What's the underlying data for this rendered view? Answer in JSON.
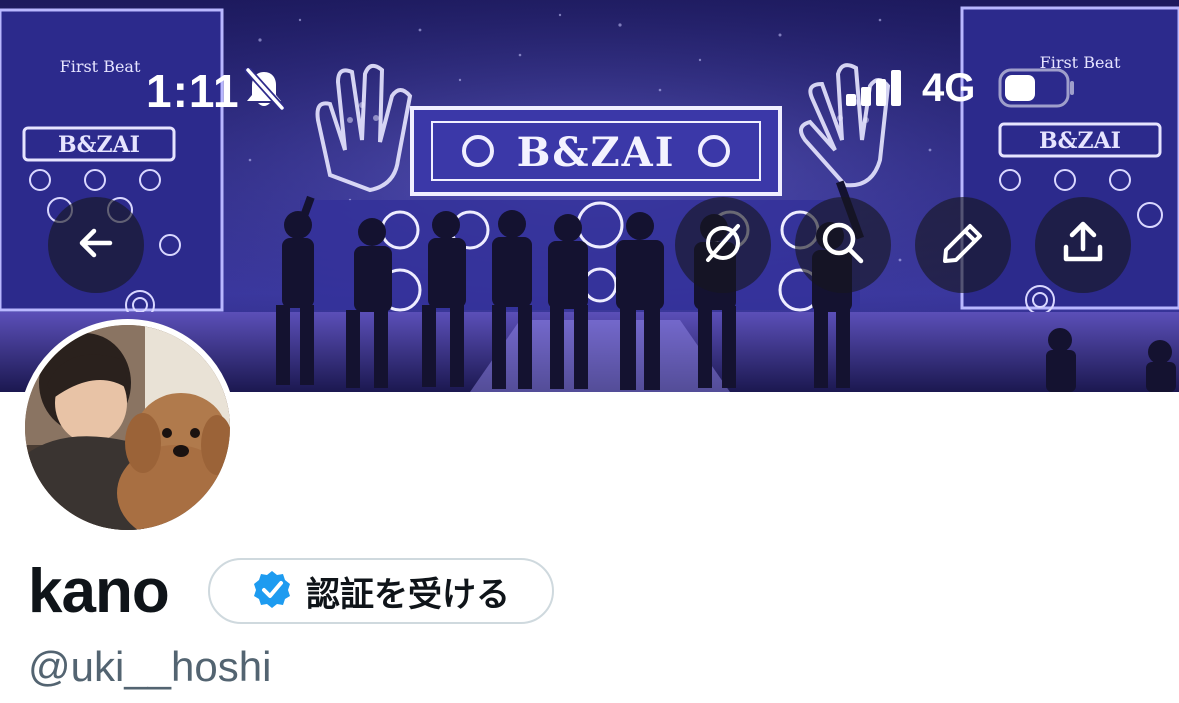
{
  "status_bar": {
    "time": "1:11",
    "network": "4G",
    "icons": [
      "bell-slash-icon",
      "signal-bars-icon",
      "battery-icon"
    ]
  },
  "banner": {
    "stage_sign": "B&ZAI",
    "screen_sign": "First Beat",
    "icon_buttons": [
      "back-arrow-icon",
      "translate-off-icon",
      "search-icon",
      "edit-pencil-icon",
      "share-icon"
    ]
  },
  "profile": {
    "display_name": "kano",
    "handle": "@uki__hoshi",
    "verify_button_label": "認証を受ける",
    "verify_icon": "verified-badge-icon"
  },
  "colors": {
    "verified_blue": "#1d9bf0",
    "text_primary": "#0f1419",
    "text_secondary": "#536471",
    "button_border": "#cfd9de"
  }
}
